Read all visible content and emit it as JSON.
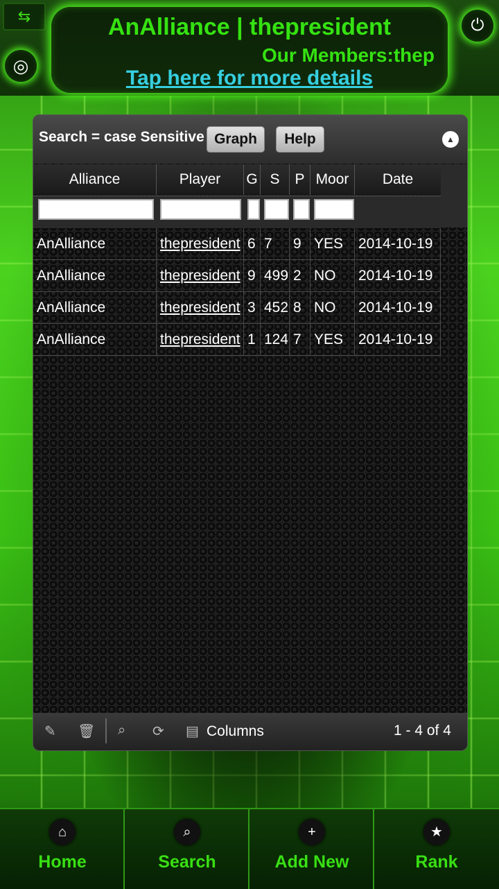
{
  "header": {
    "title": "AnAlliance | thepresident",
    "members": "Our Members:thep",
    "details_link": "Tap here for more details",
    "grid_icon": "grid-icon",
    "power_icon": "power-icon",
    "target_icon": "target-icon"
  },
  "toolbar": {
    "search_label": "Search = case Sensitive",
    "graph_label": "Graph",
    "help_label": "Help"
  },
  "table": {
    "columns": [
      "Alliance",
      "Player",
      "G",
      "S",
      "P",
      "Moor",
      "Date"
    ],
    "rows": [
      [
        "AnAlliance",
        "thepresident",
        "6",
        "7",
        "9",
        "YES",
        "2014-10-19"
      ],
      [
        "AnAlliance",
        "thepresident",
        "9",
        "499",
        "2",
        "NO",
        "2014-10-19"
      ],
      [
        "AnAlliance",
        "thepresident",
        "3",
        "452",
        "8",
        "NO",
        "2014-10-19"
      ],
      [
        "AnAlliance",
        "thepresident",
        "1",
        "124",
        "7",
        "YES",
        "2014-10-19"
      ]
    ]
  },
  "footer": {
    "columns_label": "Columns",
    "pager": "1 - 4 of 4"
  },
  "nav": {
    "items": [
      {
        "label": "Home",
        "icon": "home-icon"
      },
      {
        "label": "Search",
        "icon": "search-icon"
      },
      {
        "label": "Add New",
        "icon": "plus-icon"
      },
      {
        "label": "Rank",
        "icon": "star-icon"
      }
    ]
  },
  "colors": {
    "accent": "#35e212",
    "link": "#36cfe0"
  }
}
